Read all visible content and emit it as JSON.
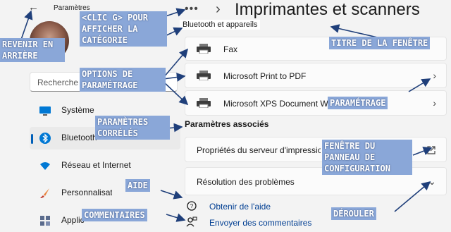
{
  "window": {
    "app_title": "Paramètres",
    "page_title": "Imprimantes et scanners",
    "breadcrumb_parent": "Bluetooth et appareils",
    "breadcrumb_more": "•••"
  },
  "sidebar": {
    "search_placeholder": "Recherche",
    "items": [
      {
        "label": "Système",
        "icon": "monitor-icon"
      },
      {
        "label": "Bluetooth et appareils",
        "icon": "bluetooth-icon"
      },
      {
        "label": "Réseau et Internet",
        "icon": "wifi-icon"
      },
      {
        "label": "Personnalisation",
        "icon": "brush-icon"
      },
      {
        "label": "Applications",
        "icon": "apps-icon"
      }
    ]
  },
  "printers": [
    {
      "label": "Fax"
    },
    {
      "label": "Microsoft Print to PDF"
    },
    {
      "label": "Microsoft XPS Document Writer"
    }
  ],
  "related": {
    "title": "Paramètres associés",
    "items": [
      {
        "label": "Propriétés du serveur d'impression",
        "icon": "open-external-icon"
      },
      {
        "label": "Résolution des problèmes",
        "icon": "chevron-down-icon"
      }
    ]
  },
  "links": [
    {
      "label": "Obtenir de l'aide",
      "icon": "help-icon"
    },
    {
      "label": "Envoyer des commentaires",
      "icon": "feedback-icon"
    }
  ],
  "annotations": {
    "back": "Revenir en arrière",
    "category": "<Clic G> pour afficher la catégorie",
    "title": "Titre de la fenêtre",
    "options": "Options de paramétrage",
    "setting": "Paramétrage",
    "related": "Paramètres corrélés",
    "control_panel": "Fenêtre du panneau de configuration",
    "help": "Aide",
    "expand": "Dérouler",
    "feedback": "Commentaires"
  },
  "colors": {
    "annotation_bg": "#8aa7d8",
    "annotation_arrow": "#1f3f7a",
    "accent": "#005fb8",
    "link": "#003e92"
  }
}
